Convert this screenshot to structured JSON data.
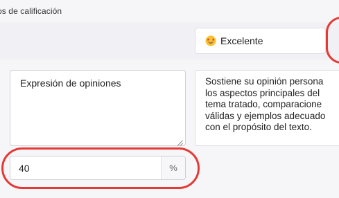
{
  "section": {
    "title": "os de calificación"
  },
  "level": {
    "emoji_icon": "star-struck-face-icon",
    "label": "Excelente"
  },
  "criterion": {
    "name": "Expresión de opiniones"
  },
  "description": {
    "lines": [
      "Sostiene su opinión persona",
      "los aspectos principales del",
      "tema tratado, comparacione",
      "válidas y ejemplos adecuado",
      "con el propósito del texto."
    ]
  },
  "weight": {
    "value": "40",
    "unit": "%"
  },
  "annotations": {
    "highlight_color": "#e53935"
  }
}
